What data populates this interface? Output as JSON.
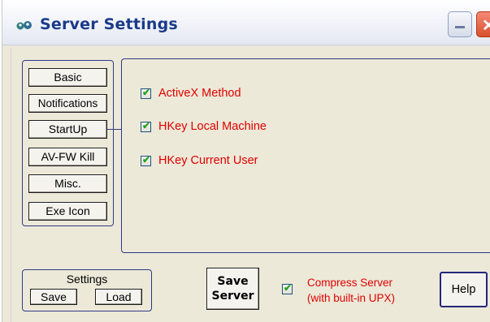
{
  "window": {
    "title": "Server Settings"
  },
  "nav": {
    "items": [
      {
        "label": "Basic"
      },
      {
        "label": "Notifications"
      },
      {
        "label": "StartUp"
      },
      {
        "label": "AV-FW Kill"
      },
      {
        "label": "Misc."
      },
      {
        "label": "Exe Icon"
      }
    ],
    "selected": "StartUp"
  },
  "startup_options": [
    {
      "label": "ActiveX Method",
      "checked": true
    },
    {
      "label": "HKey Local Machine",
      "checked": true
    },
    {
      "label": "HKey Current User",
      "checked": true
    }
  ],
  "settings_group": {
    "label": "Settings",
    "save_label": "Save",
    "load_label": "Load"
  },
  "save_server": {
    "line1": "Save",
    "line2": "Server"
  },
  "compress": {
    "line1": "Compress Server",
    "line2": "(with built-in UPX)",
    "checked": true
  },
  "help_label": "Help",
  "colors": {
    "title_text": "#1a3a8a",
    "group_border": "#2f3a86",
    "option_text": "#e00000",
    "checkmark": "#21a121"
  },
  "icons": {
    "app": "app-icon",
    "minimize": "minimize-icon",
    "close": "close-icon",
    "check": "checkmark-icon"
  }
}
